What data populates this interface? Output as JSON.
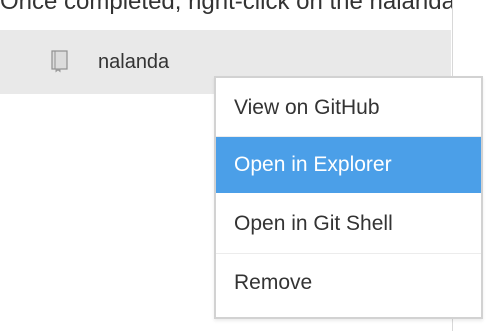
{
  "top_text": {
    "partial": "Once completed, right-click on the nalanda rep",
    "right": "r"
  },
  "repository": {
    "name": "nalanda",
    "icon": "repository-book-icon"
  },
  "context_menu": {
    "items": [
      {
        "label": "View on GitHub",
        "selected": false
      },
      {
        "label": "Open in Explorer",
        "selected": true
      },
      {
        "label": "Open in Git Shell",
        "selected": false
      },
      {
        "label": "Remove",
        "selected": false
      }
    ],
    "selected_color": "#4b9fe8"
  },
  "colors": {
    "row_background": "#e9e9e9",
    "text": "#333333",
    "menu_border": "#d2d2d2"
  }
}
